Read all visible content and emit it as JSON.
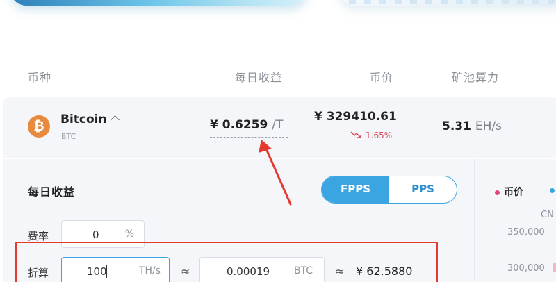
{
  "header": {
    "coin": "币种",
    "daily": "每日收益",
    "price": "币价",
    "hashrate": "矿池算力"
  },
  "coin": {
    "icon": "bitcoin-icon",
    "icon_glyph": "₿",
    "name": "Bitcoin",
    "symbol": "BTC",
    "daily_value": "¥ 0.6259",
    "daily_unit": "/T",
    "price": "¥ 329410.61",
    "change": "1.65%",
    "change_direction": "down",
    "hashrate_value": "5.31",
    "hashrate_unit": "EH/s"
  },
  "calculator": {
    "title": "每日收益",
    "modes": [
      "FPPS",
      "PPS"
    ],
    "active_mode": "FPPS",
    "fee_label": "费率",
    "fee_value": "0",
    "fee_unit": "%",
    "convert_label": "折算",
    "hash_value": "100",
    "hash_unit": "TH/s",
    "approx": "≈",
    "btc_value": "0.00019",
    "btc_unit": "BTC",
    "cny_value": "¥ 62.5880"
  },
  "chart": {
    "legend_price": "币价",
    "axis_label": "CN",
    "ticks": [
      "350,000",
      "300,000"
    ]
  },
  "colors": {
    "accent": "#3aa5e0",
    "bitcoin": "#e88a3e",
    "down": "#e0455c",
    "annotation": "#e23b2e"
  }
}
